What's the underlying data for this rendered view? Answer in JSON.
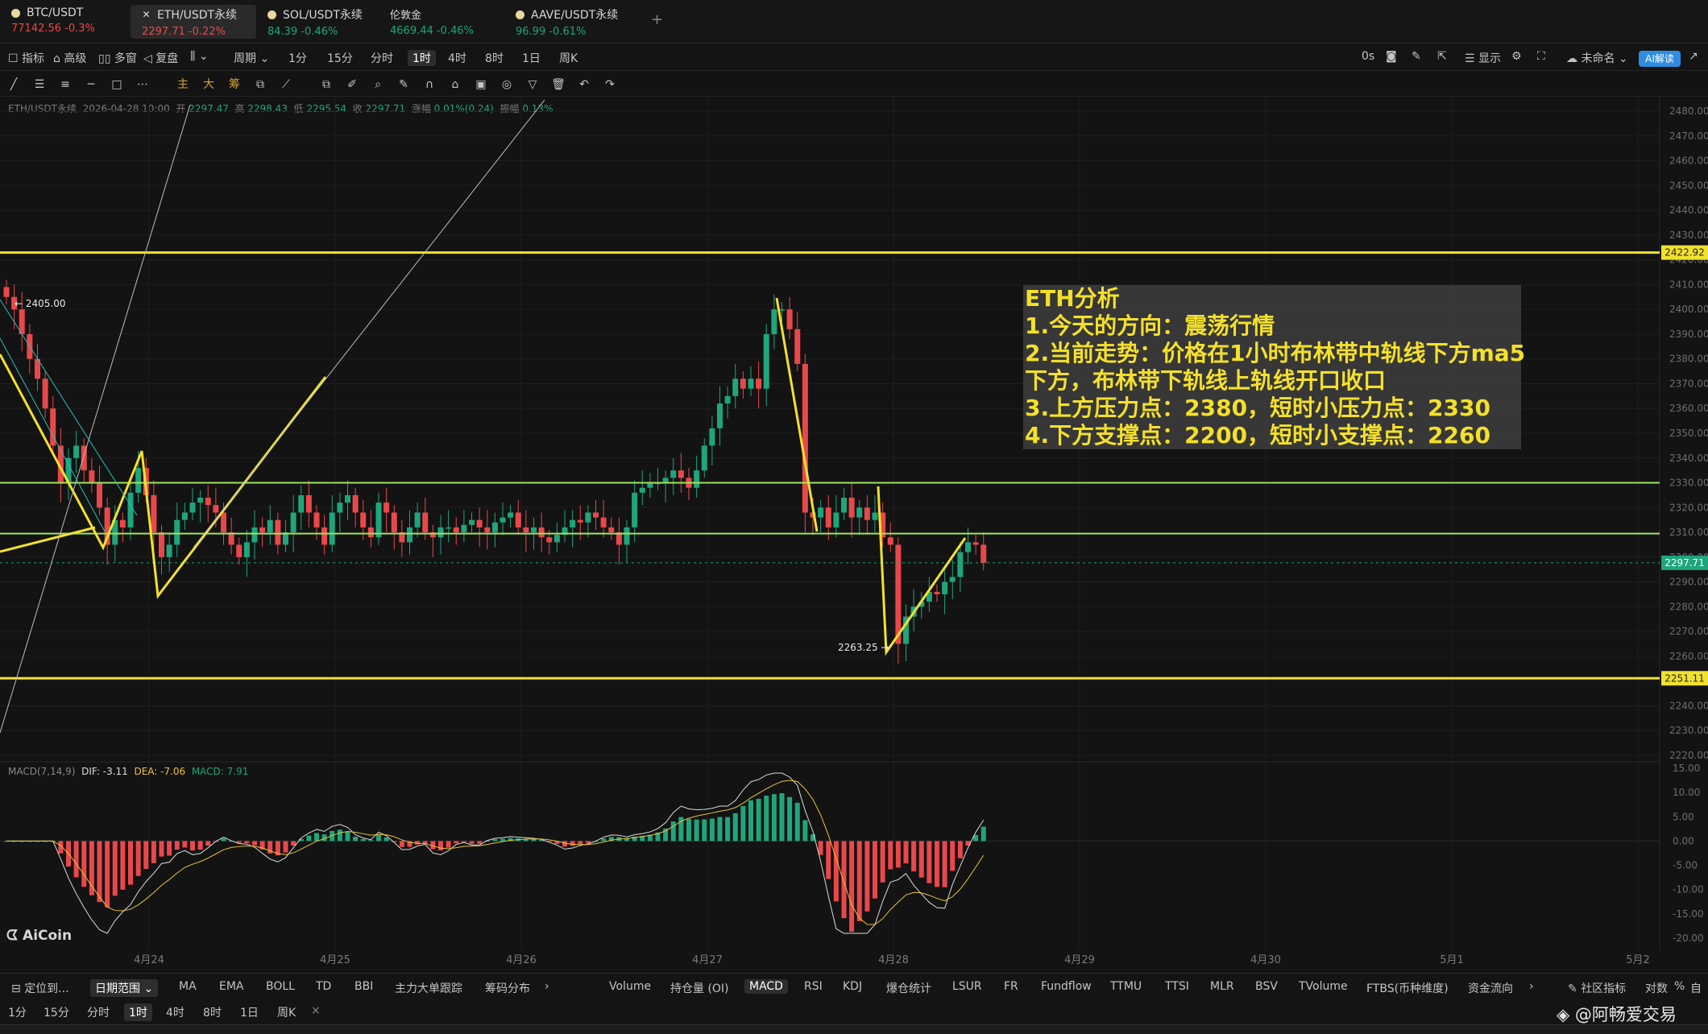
{
  "tickers": [
    {
      "name": "BTC/USDT",
      "price": "77142.56",
      "change": "-0.3%",
      "dir": "dn",
      "active": false
    },
    {
      "name": "ETH/USDT永续",
      "price": "2297.71",
      "change": "-0.22%",
      "dir": "dn",
      "active": true
    },
    {
      "name": "SOL/USDT永续",
      "price": "84.39",
      "change": "-0.46%",
      "dir": "up",
      "active": false
    },
    {
      "name": "伦敦金",
      "price": "4669.44",
      "change": "-0.46%",
      "dir": "up",
      "active": false
    },
    {
      "name": "AAVE/USDT永续",
      "price": "96.99",
      "change": "-0.61%",
      "dir": "up",
      "active": false
    }
  ],
  "toolbar": {
    "indicators": "指标",
    "advanced": "高级",
    "multiwindow": "多窗",
    "replay": "复盘",
    "period": "周期",
    "intervals": [
      "1分",
      "15分",
      "分时",
      "1时",
      "4时",
      "8时",
      "1日",
      "周K"
    ],
    "selected_interval": "1时",
    "countdown": "0s",
    "display": "显示",
    "unnamed": "未命名",
    "ai": "AI解读"
  },
  "legend": {
    "symbol": "ETH/USDT永续",
    "datetime": "2026-04-28 10:00",
    "open_label": "开",
    "open": "2297.47",
    "high_label": "高",
    "high": "2298.43",
    "low_label": "低",
    "low": "2295.54",
    "close_label": "收",
    "close": "2297.71",
    "chg_label": "涨幅",
    "chg": "0.01%(0.24)",
    "amp_label": "振幅",
    "amp": "0.13%"
  },
  "macd_legend": {
    "name": "MACD(7,14,9)",
    "dif": "DIF: -3.11",
    "dea": "DEA: -7.06",
    "macd": "MACD: 7.91"
  },
  "annotation": {
    "lines": [
      "ETH分析",
      "1.今天的方向：震荡行情",
      "2.当前走势：价格在1小时布林带中轨线下方ma5",
      "下方，布林带下轨线上轨线开口收口",
      "3.上方压力点：2380，短时小压力点：2330",
      "4.下方支撑点：2200，短时小支撑点：2260"
    ]
  },
  "chart_labels": {
    "high_marker": "2405.00",
    "low_marker": "2263.25",
    "resistance_tag": "2422.92",
    "support_tag": "2251.11",
    "last_price_tag": "2297.71"
  },
  "colors": {
    "up": "#1fa57c",
    "down": "#e9484b",
    "level_yellow": "#f2e12e",
    "level_green": "#9ee35a",
    "annotation_text": "#f4e02a"
  },
  "chart_data": {
    "type": "candlestick",
    "interval": "1h",
    "price_axis_ticks": [
      2480,
      2470,
      2460,
      2450,
      2440,
      2430,
      2420,
      2410,
      2400,
      2390,
      2380,
      2370,
      2360,
      2350,
      2340,
      2330,
      2320,
      2310,
      2300,
      2290,
      2280,
      2270,
      2260,
      2250,
      2240,
      2230,
      2220
    ],
    "price_axis_label_suffix": ".00",
    "macd_axis_ticks": [
      "15.00",
      "10.00",
      "5.00",
      "0.00",
      "-5.00",
      "-10.00",
      "-15.00",
      "-20.00"
    ],
    "date_ticks": [
      "4月24",
      "4月25",
      "4月26",
      "4月27",
      "4月28",
      "4月29",
      "4月30",
      "5月1",
      "5月2"
    ],
    "horizontal_levels": [
      {
        "price": 2422.92,
        "color": "yellow"
      },
      {
        "price": 2330,
        "color": "green"
      },
      {
        "price": 2309.5,
        "color": "green"
      },
      {
        "price": 2251.11,
        "color": "yellow"
      }
    ],
    "last_price": 2297.71,
    "period_high": 2405.0,
    "period_low": 2263.25,
    "closes": [
      2405,
      2400,
      2390,
      2380,
      2372,
      2360,
      2345,
      2330,
      2340,
      2345,
      2335,
      2330,
      2320,
      2305,
      2315,
      2312,
      2326,
      2336,
      2325,
      2310,
      2300,
      2305,
      2315,
      2318,
      2322,
      2324,
      2321,
      2318,
      2310,
      2305,
      2300,
      2306,
      2312,
      2310,
      2315,
      2305,
      2310,
      2318,
      2325,
      2318,
      2312,
      2305,
      2318,
      2322,
      2325,
      2318,
      2312,
      2308,
      2322,
      2318,
      2310,
      2306,
      2312,
      2318,
      2310,
      2308,
      2312,
      2312,
      2310,
      2313,
      2315,
      2312,
      2310,
      2314,
      2316,
      2318,
      2312,
      2310,
      2312,
      2308,
      2306,
      2309,
      2312,
      2315,
      2314,
      2318,
      2316,
      2312,
      2310,
      2305,
      2312,
      2326,
      2328,
      2330,
      2330,
      2332,
      2335,
      2332,
      2328,
      2335,
      2345,
      2352,
      2362,
      2365,
      2372,
      2368,
      2372,
      2368,
      2390,
      2400,
      2400,
      2392,
      2378,
      2318,
      2316,
      2320,
      2312,
      2318,
      2324,
      2316,
      2320,
      2315,
      2318,
      2308,
      2305,
      2265,
      2276,
      2280,
      2282,
      2286,
      2285,
      2290,
      2292,
      2302,
      2306,
      2305,
      2297.71
    ],
    "macd_hist_shape": "negative bars early 4月24, small oscillation 4月25–4月26, positive 4月27, deep negative 4月28 drop, recovering positive at end"
  },
  "indicator_tabs": {
    "left": [
      "定位到...",
      "日期范围"
    ],
    "overlays": [
      "MA",
      "EMA",
      "BOLL",
      "TD",
      "BBI",
      "主力大单跟踪",
      "筹码分布"
    ],
    "subcharts": [
      "Volume",
      "持仓量 (OI)",
      "MACD",
      "RSI",
      "KDJ",
      "爆仓统计",
      "LSUR",
      "FR",
      "Fundflow",
      "TTMU",
      "TTSI",
      "MLR",
      "BSV",
      "TVolume",
      "FTBS(币种维度)",
      "资金流向"
    ],
    "selected_subchart": "MACD",
    "right": [
      "社区指标",
      "对数",
      "%",
      "自"
    ]
  },
  "period_bar": {
    "items": [
      "1分",
      "15分",
      "分时",
      "1时",
      "4时",
      "8时",
      "1日",
      "周K"
    ],
    "selected": "1时"
  },
  "brand": {
    "logo": "AiCoin",
    "watermark": "@阿畅爱交易"
  }
}
